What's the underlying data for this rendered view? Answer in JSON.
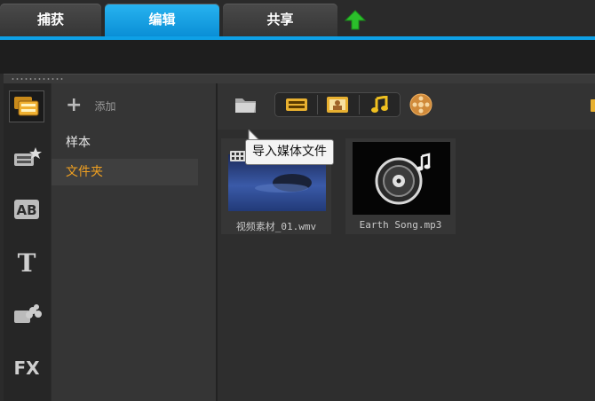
{
  "tabs": [
    {
      "label": "捕获",
      "active": false
    },
    {
      "label": "编辑",
      "active": true
    },
    {
      "label": "共享",
      "active": false
    }
  ],
  "upload_icon": "upload-arrow-icon",
  "colors": {
    "accent": "#0ea0e6",
    "selected_text": "#f0a020",
    "upload_green": "#2bbf2b"
  },
  "rail": [
    "media-library-icon",
    "transition-icon",
    "title-icon",
    "text-icon",
    "graphics-icon",
    "fx-icon"
  ],
  "rail_fx_label": "FX",
  "rail_ab_label": "AB",
  "rail_t_label": "T",
  "category_panel": {
    "add_label": "添加",
    "items": [
      {
        "label": "样本",
        "selected": false
      },
      {
        "label": "文件夹",
        "selected": true
      }
    ]
  },
  "toolbar": {
    "import_icon": "folder-icon",
    "filters": [
      "video-filter-icon",
      "image-filter-icon",
      "audio-filter-icon"
    ],
    "extra": "reel-icon"
  },
  "tooltip": "导入媒体文件",
  "media_items": [
    {
      "name": "视频素材_01.wmv",
      "type": "video"
    },
    {
      "name": "Earth Song.mp3",
      "type": "audio"
    }
  ]
}
